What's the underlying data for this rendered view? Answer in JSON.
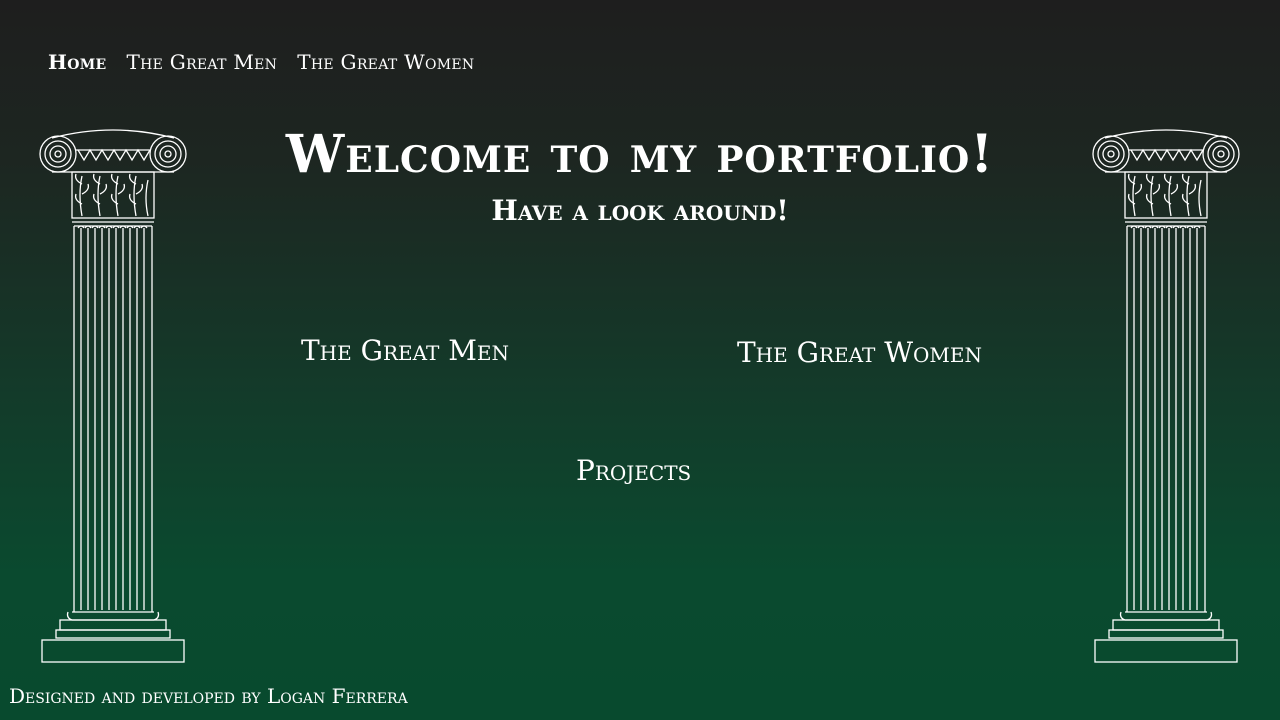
{
  "nav": {
    "items": [
      {
        "label": "Home",
        "active": true
      },
      {
        "label": "The Great Men",
        "active": false
      },
      {
        "label": "The Great Women",
        "active": false
      }
    ]
  },
  "hero": {
    "title": "Welcome to my portfolio!",
    "subtitle": "Have a look around!"
  },
  "links": {
    "great_men": "The Great Men",
    "great_women": "The Great Women",
    "projects": "Projects"
  },
  "footer": {
    "credit": "Designed and developed by Logan Ferrera"
  },
  "colors": {
    "background_top": "#1e1e1e",
    "background_bottom": "#084a2e",
    "text": "#ffffff",
    "pillar_stroke": "#ffffff"
  },
  "icons": [
    "ionic-column-icon"
  ]
}
